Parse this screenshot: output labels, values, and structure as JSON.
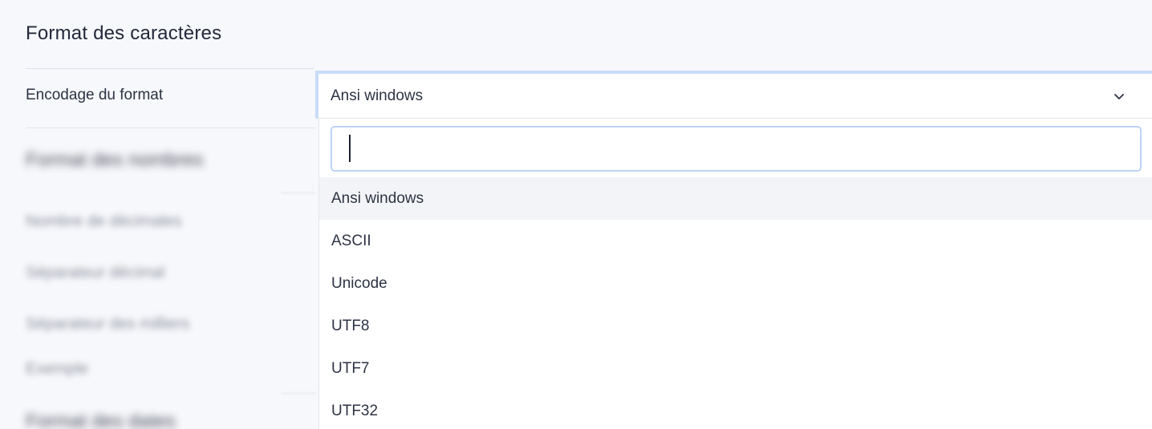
{
  "section": {
    "title": "Format des caractères"
  },
  "encoding": {
    "label": "Encodage du format",
    "selected": "Ansi windows",
    "search_value": "",
    "options": [
      "Ansi windows",
      "ASCII",
      "Unicode",
      "UTF8",
      "UTF7",
      "UTF32"
    ],
    "highlighted": "Ansi windows"
  },
  "blurred": {
    "numbers_title": "Format des nombres",
    "labels": [
      "Nombre de décimales",
      "Séparateur décimal",
      "Séparateur des milliers",
      "Exemple"
    ],
    "dates_title": "Format des dates"
  },
  "colors": {
    "focus_border": "#c8dcf7",
    "highlight_bg": "#f3f4f7",
    "panel_bg": "#f7f8fb"
  },
  "icons": {
    "dropdown": "chevron-down-icon"
  }
}
